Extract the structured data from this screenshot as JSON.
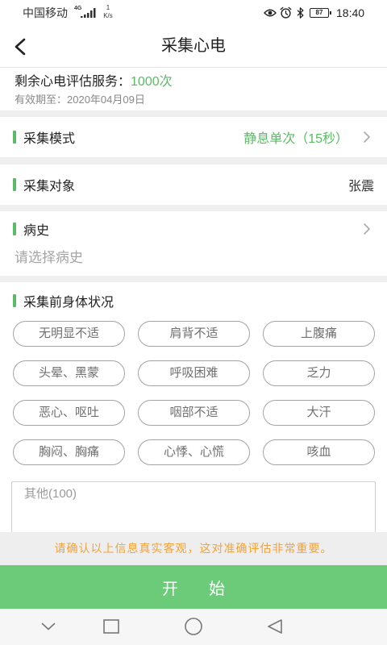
{
  "status_bar": {
    "carrier": "中国移动",
    "network": "4G",
    "speed_value": "1",
    "speed_unit": "K/s",
    "battery": "87",
    "time": "18:40"
  },
  "header": {
    "title": "采集心电"
  },
  "service": {
    "label": "剩余心电评估服务：",
    "count": "1000次",
    "expiry": "有效期至：2020年04月09日"
  },
  "mode": {
    "label": "采集模式",
    "value": "静息单次（15秒）"
  },
  "subject": {
    "label": "采集对象",
    "value": "张震"
  },
  "history": {
    "label": "病史",
    "placeholder": "请选择病史"
  },
  "condition": {
    "label": "采集前身体状况",
    "options": [
      "无明显不适",
      "肩背不适",
      "上腹痛",
      "头晕、黑蒙",
      "呼吸困难",
      "乏力",
      "恶心、呕吐",
      "咽部不适",
      "大汗",
      "胸闷、胸痛",
      "心悸、心慌",
      "咳血"
    ],
    "other_placeholder": "其他(100)"
  },
  "notice": "请确认以上信息真实客观，这对准确评估非常重要。",
  "start_button": "开始",
  "icons": {
    "status": [
      "signal-icon",
      "eye-icon",
      "alarm-icon",
      "bluetooth-icon",
      "battery-icon"
    ],
    "back": "back-arrow-icon",
    "row_chevron": "chevron-right-icon",
    "nav": [
      "chevron-down-icon",
      "square-icon",
      "circle-icon",
      "triangle-back-icon"
    ]
  },
  "colors": {
    "accent": "#5cba66",
    "start_button": "#6ccb78",
    "notice_text": "#f0a33a",
    "notice_background": "#eeeeee",
    "divider": "#efefef"
  }
}
